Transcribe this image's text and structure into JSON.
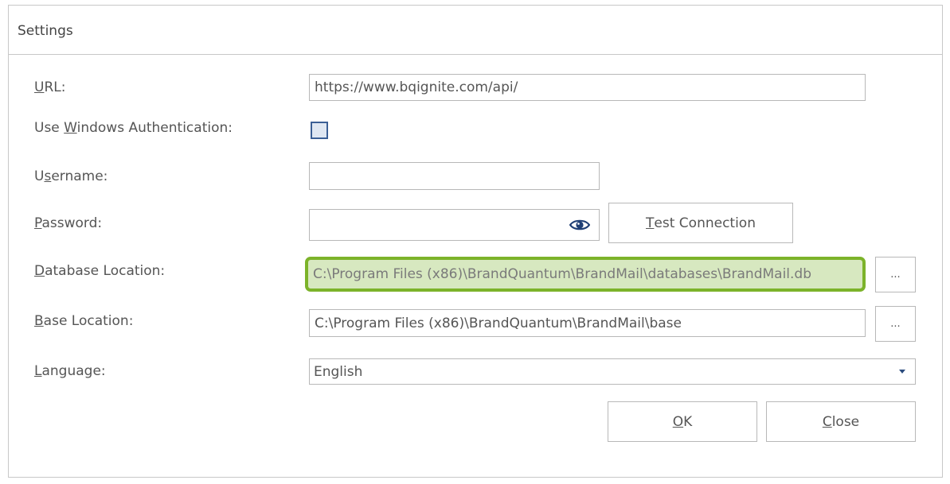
{
  "dialog": {
    "title": "Settings"
  },
  "url": {
    "label_underlined": "U",
    "label_rest": "RL:",
    "value": "https://www.bqignite.com/api/"
  },
  "windows_auth": {
    "label_before": "Use ",
    "label_underlined": "W",
    "label_after": "indows Authentication:",
    "checked": false
  },
  "username": {
    "label_before": "U",
    "label_underlined": "s",
    "label_after": "ername:",
    "value": ""
  },
  "password": {
    "label_underlined": "P",
    "label_rest": "assword:",
    "value": "",
    "reveal_icon": "eye-icon"
  },
  "test_connection": {
    "label_underlined": "T",
    "label_rest": "est Connection"
  },
  "database_location": {
    "label_underlined": "D",
    "label_rest": "atabase Location:",
    "value": "C:\\Program Files (x86)\\BrandQuantum\\BrandMail\\databases\\BrandMail.db",
    "browse_label": "...",
    "highlight_color": "#7cb32a"
  },
  "base_location": {
    "label_underlined": "B",
    "label_rest": "ase Location:",
    "value": "C:\\Program Files (x86)\\BrandQuantum\\BrandMail\\base",
    "browse_label": "..."
  },
  "language": {
    "label_underlined": "L",
    "label_rest": "anguage:",
    "selected": "English",
    "dropdown_icon": "caret-down-icon"
  },
  "footer": {
    "ok_underlined": "O",
    "ok_rest": "K",
    "close_underlined": "C",
    "close_rest": "lose"
  }
}
